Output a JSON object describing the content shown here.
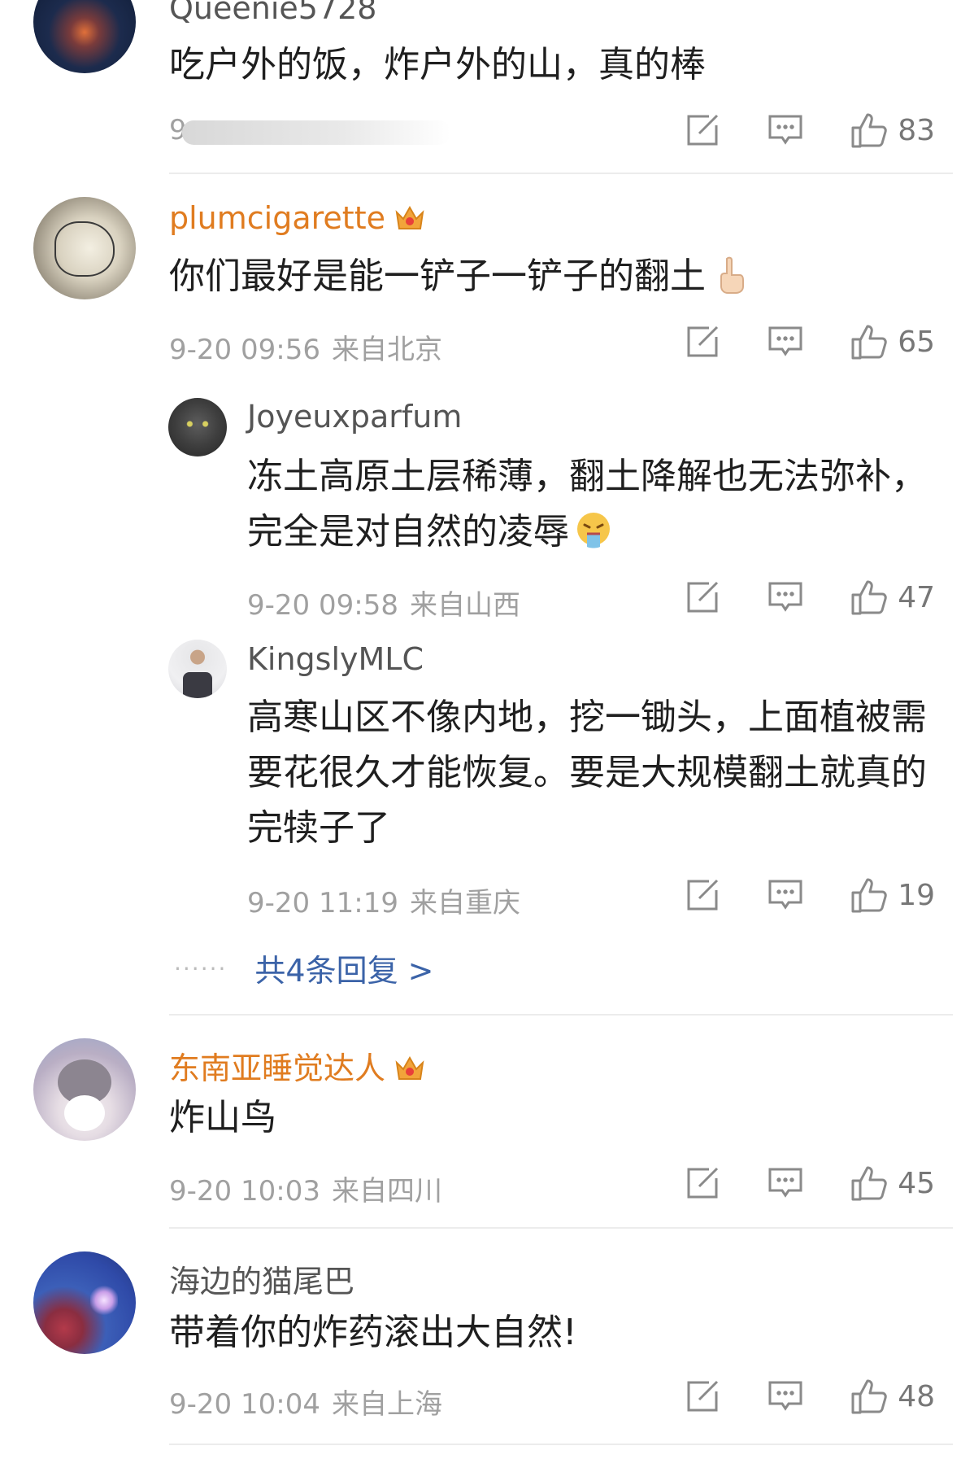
{
  "icons": {
    "share": "edit-share-icon",
    "reply": "comment-bubble-icon",
    "like": "thumbs-up-icon",
    "vip": "crown-badge-icon"
  },
  "colors": {
    "vip_nick": "#e07c20",
    "link": "#3b63a8",
    "meta": "#a0a0a0"
  },
  "comments": [
    {
      "nick": "Queenie5728",
      "text": "吃户外的饭，炸户外的山，真的棒",
      "time": "9",
      "location": "",
      "likes": "83"
    },
    {
      "nick": "plumcigarette",
      "text": "你们最好是能一铲子一铲子的翻土",
      "emoji": "pointing-up-finger-emoji",
      "time": "9-20 09:56",
      "location": "来自北京",
      "likes": "65",
      "replies": [
        {
          "nick": "Joyeuxparfum",
          "text": "冻土高原土层稀薄，翻土降解也无法弥补，完全是对自然的凌辱",
          "emoji": "vomiting-face-emoji",
          "time": "9-20 09:58",
          "location": "来自山西",
          "likes": "47"
        },
        {
          "nick": "KingslyMLC",
          "text": "高寒山区不像内地，挖一锄头，上面植被需要花很久才能恢复。要是大规模翻土就真的完犊子了",
          "time": "9-20 11:19",
          "location": "来自重庆",
          "likes": "19"
        }
      ],
      "more_replies": "共4条回复 >"
    },
    {
      "nick": "东南亚睡觉达人",
      "text": "炸山鸟",
      "time": "9-20 10:03",
      "location": "来自四川",
      "likes": "45"
    },
    {
      "nick": "海边的猫尾巴",
      "text": "带着你的炸药滚出大自然!",
      "time": "9-20 10:04",
      "location": "来自上海",
      "likes": "48"
    }
  ]
}
